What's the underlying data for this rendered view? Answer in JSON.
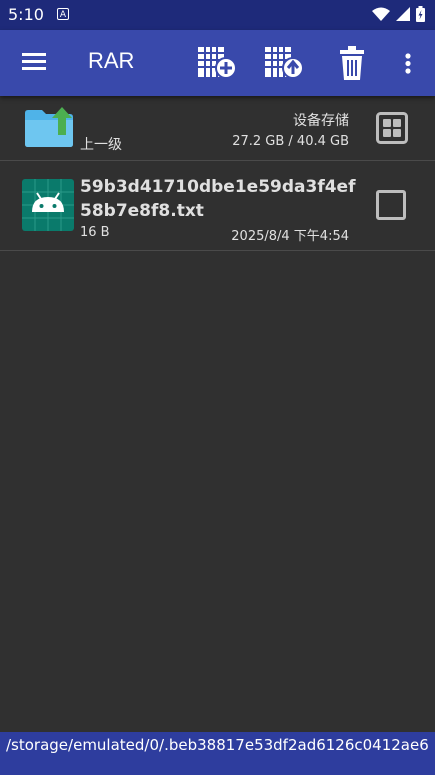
{
  "status_bar": {
    "time": "5:10",
    "notification_icon": "A"
  },
  "toolbar": {
    "title": "RAR",
    "actions": [
      "menu-icon",
      "add-to-archive-icon",
      "extract-icon",
      "delete-icon",
      "more-vert-icon"
    ]
  },
  "parent_dir": {
    "label": "上一级",
    "storage_label": "设备存储",
    "storage_size": "27.2 GB / 40.4 GB"
  },
  "files": [
    {
      "name": "59b3d41710dbe1e59da3f4ef58b7e8f8.txt",
      "size": "16 B",
      "date": "2025/8/4 下午4:54",
      "checked": false
    }
  ],
  "path": "/storage/emulated/0/.beb38817e53df2ad6126c0412ae6",
  "colors": {
    "appbar": "#3949ab",
    "statusbar": "#1e2a7a",
    "background": "#303030",
    "pathbar": "#2e3d9e"
  }
}
